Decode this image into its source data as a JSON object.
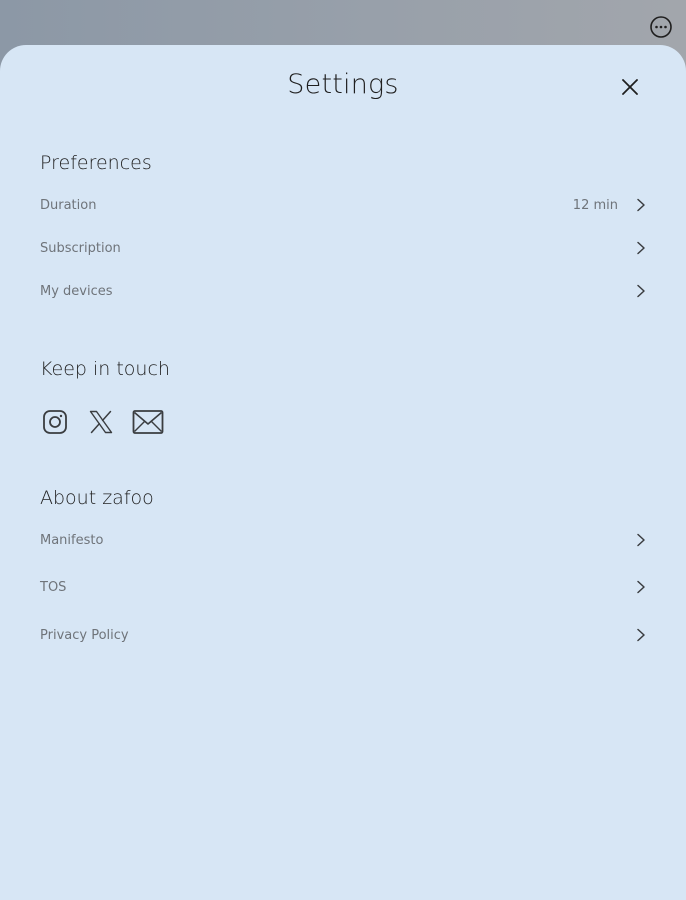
{
  "header": {
    "title": "Settings"
  },
  "icons": {
    "more": "more-horizontal-circle-icon",
    "close": "close-icon",
    "chevron": "chevron-right-icon",
    "instagram": "instagram-icon",
    "x": "x-twitter-icon",
    "email": "mail-icon"
  },
  "colors": {
    "sheet_background": "#d7e6f5",
    "backdrop": "#939ca7",
    "title_text": "#1f1f1f",
    "row_text": "#6f747a",
    "icon": "#3a3d40"
  },
  "preferences": {
    "title": "Preferences",
    "items": [
      {
        "label": "Duration",
        "value": "12 min"
      },
      {
        "label": "Subscription",
        "value": ""
      },
      {
        "label": "My devices",
        "value": ""
      }
    ]
  },
  "keep_in_touch": {
    "title": "Keep in touch"
  },
  "about": {
    "title": "About zafoo",
    "items": [
      {
        "label": "Manifesto"
      },
      {
        "label": "TOS"
      },
      {
        "label": "Privacy Policy"
      }
    ]
  }
}
